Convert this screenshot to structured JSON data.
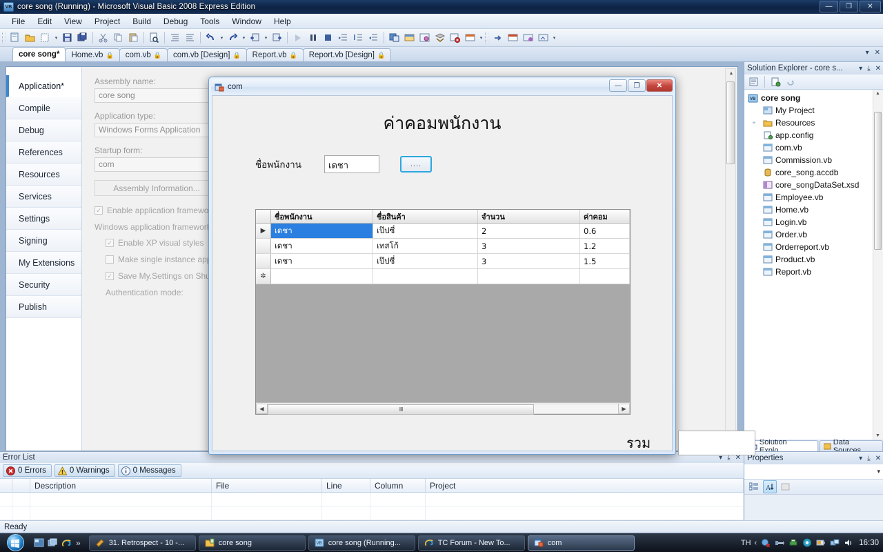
{
  "ide": {
    "title": "core song (Running) - Microsoft Visual Basic 2008 Express Edition",
    "title_icon": "vb-icon",
    "window_buttons": {
      "minimize": "—",
      "maximize": "❐",
      "close": "✕"
    },
    "menu": [
      "File",
      "Edit",
      "View",
      "Project",
      "Build",
      "Debug",
      "Tools",
      "Window",
      "Help"
    ],
    "toolbar_icons": [
      "new-project-icon",
      "open-file-icon",
      "add-new-item-icon",
      "add-item-dropdown",
      "save-icon",
      "save-all-icon",
      "cut-icon",
      "copy-icon",
      "paste-icon",
      "find-in-files-icon",
      "comment-icon",
      "uncomment-icon",
      "undo-icon",
      "undo-dropdown",
      "redo-icon",
      "redo-dropdown",
      "navigate-back-icon",
      "navigate-back-dropdown",
      "navigate-forward-icon",
      "start-debug-icon",
      "pause-icon",
      "stop-icon",
      "step-into-icon",
      "step-over-icon",
      "step-out-icon",
      "solution-explorer-icon",
      "properties-window-icon",
      "object-browser-icon",
      "toolbox-icon",
      "error-list-icon",
      "immediate-window-icon",
      "toolbar-overflow",
      "go-icon",
      "window-1-icon",
      "window-2-icon",
      "window-3-icon",
      "toolbar-overflow-2"
    ],
    "tabs": [
      {
        "label": "core song*",
        "active": true,
        "locked": false
      },
      {
        "label": "Home.vb",
        "active": false,
        "locked": true
      },
      {
        "label": "com.vb",
        "active": false,
        "locked": true
      },
      {
        "label": "com.vb [Design]",
        "active": false,
        "locked": true
      },
      {
        "label": "Report.vb",
        "active": false,
        "locked": true
      },
      {
        "label": "Report.vb [Design]",
        "active": false,
        "locked": true
      }
    ],
    "tabstrip_buttons": {
      "dropdown": "▾",
      "close": "✕"
    },
    "status": "Ready"
  },
  "property_page": {
    "tabs": [
      "Application*",
      "Compile",
      "Debug",
      "References",
      "Resources",
      "Services",
      "Settings",
      "Signing",
      "My Extensions",
      "Security",
      "Publish"
    ],
    "active_tab": "Application*",
    "fields": [
      {
        "label": "Assembly name:",
        "value": "core song"
      },
      {
        "label": "Application type:",
        "value": "Windows Forms Application"
      },
      {
        "label": "Startup form:",
        "value": "com"
      }
    ],
    "assembly_info_button": "Assembly Information...",
    "enable_framework": {
      "label": "Enable application framework",
      "checked": true,
      "mark": "✓"
    },
    "framework_group": "Windows application framework properties",
    "framework_options": [
      {
        "label": "Enable XP visual styles",
        "checked": true,
        "mark": "✓"
      },
      {
        "label": "Make single instance application",
        "checked": false,
        "mark": ""
      },
      {
        "label": "Save My.Settings on Shutdown",
        "checked": true,
        "mark": "✓"
      }
    ],
    "auth_label": "Authentication mode:",
    "scroll_up": "▲",
    "scroll_down": "▼"
  },
  "error_list": {
    "title": "Error List",
    "panel_buttons": {
      "dropdown": "▾",
      "pin": "⤓",
      "close": "✕"
    },
    "pills": [
      {
        "icon": "error-icon",
        "label": "0 Errors",
        "color": "#cc2b2b"
      },
      {
        "icon": "warning-icon",
        "label": "0 Warnings",
        "color": "#ffd24a"
      },
      {
        "icon": "info-icon",
        "label": "0 Messages",
        "color": "#4a6f9e"
      }
    ],
    "columns": [
      "",
      "",
      "Description",
      "File",
      "Line",
      "Column",
      "Project"
    ]
  },
  "solution_explorer": {
    "title": "Solution Explorer - core s...",
    "panel_buttons": {
      "dropdown": "▾",
      "pin": "⤓",
      "close": "✕"
    },
    "toolbar_icons": [
      "properties-icon",
      "show-all-files-icon",
      "refresh-icon"
    ],
    "root": {
      "label": "core song",
      "icon": "vb-project-icon"
    },
    "items": [
      {
        "label": "My Project",
        "icon": "my-project-icon",
        "expander": ""
      },
      {
        "label": "Resources",
        "icon": "folder-icon",
        "expander": "+"
      },
      {
        "label": "app.config",
        "icon": "config-file-icon",
        "expander": ""
      },
      {
        "label": "com.vb",
        "icon": "form-icon",
        "expander": ""
      },
      {
        "label": "Commission.vb",
        "icon": "form-icon",
        "expander": ""
      },
      {
        "label": "core_song.accdb",
        "icon": "database-icon",
        "expander": ""
      },
      {
        "label": "core_songDataSet.xsd",
        "icon": "dataset-icon",
        "expander": ""
      },
      {
        "label": "Employee.vb",
        "icon": "form-icon",
        "expander": ""
      },
      {
        "label": "Home.vb",
        "icon": "form-icon",
        "expander": ""
      },
      {
        "label": "Login.vb",
        "icon": "form-icon",
        "expander": ""
      },
      {
        "label": "Order.vb",
        "icon": "form-icon",
        "expander": ""
      },
      {
        "label": "Orderreport.vb",
        "icon": "form-icon",
        "expander": ""
      },
      {
        "label": "Product.vb",
        "icon": "form-icon",
        "expander": ""
      },
      {
        "label": "Report.vb",
        "icon": "form-icon",
        "expander": ""
      }
    ],
    "scroll_up": "▲",
    "scroll_down": "▼",
    "dock_tabs": [
      {
        "label": "Solution Explo...",
        "icon": "solution-explorer-icon",
        "active": true
      },
      {
        "label": "Data Sources",
        "icon": "data-sources-icon",
        "active": false
      }
    ]
  },
  "properties_panel": {
    "title": "Properties",
    "panel_buttons": {
      "dropdown": "▾",
      "pin": "⤓",
      "close": "✕"
    },
    "combo_value": "",
    "combo_arrow": "▾",
    "toolbar_icons": [
      "categorized-icon",
      "alphabetical-icon",
      "property-pages-icon"
    ]
  },
  "com_form": {
    "title": "com",
    "title_icon": "form-icon",
    "buttons": {
      "minimize": "—",
      "maximize": "❐",
      "close": "✕"
    },
    "heading": "ค่าคอมพนักงาน",
    "name_label": "ชื่อพนักงาน",
    "name_value": "เดชา",
    "browse_button": "....",
    "total_label": "รวม",
    "total_value": "",
    "grid": {
      "columns": [
        "ชื่อพนักงาน",
        "ชื่อสินค้า",
        "จำนวน",
        "ค่าคอม"
      ],
      "rows": [
        {
          "marker": "▶",
          "selected": true,
          "cells": [
            "เดชา",
            "เป๊ปซี่",
            "2",
            "0.6"
          ]
        },
        {
          "marker": "",
          "selected": false,
          "cells": [
            "เดชา",
            "เทสโก้",
            "3",
            "1.2"
          ]
        },
        {
          "marker": "",
          "selected": false,
          "cells": [
            "เดชา",
            "เป๊ปซี่",
            "3",
            "1.5"
          ]
        },
        {
          "marker": "✲",
          "selected": false,
          "cells": [
            "",
            "",
            "",
            ""
          ]
        }
      ],
      "hscroll": {
        "left": "◀",
        "right": "▶",
        "grip": "‖‖"
      }
    }
  },
  "taskbar": {
    "start_icon": "windows-orb-icon",
    "quick_launch": [
      {
        "icon": "show-desktop-icon"
      },
      {
        "icon": "switch-windows-icon"
      },
      {
        "icon": "internet-explorer-icon"
      }
    ],
    "overflow": "»",
    "items": [
      {
        "label": "31. Retrospect - 10 -...",
        "icon": "media-icon",
        "active": false
      },
      {
        "label": "core song",
        "icon": "folder-icon",
        "active": false
      },
      {
        "label": "core song (Running...",
        "icon": "vb-icon",
        "active": false
      },
      {
        "label": "TC Forum - New To...",
        "icon": "internet-explorer-icon",
        "active": false
      },
      {
        "label": "com",
        "icon": "form-icon",
        "active": true
      }
    ],
    "language": "TH",
    "tray_expand": "‹",
    "tray_icons": [
      "antivirus-icon",
      "usb-icon",
      "printer-icon",
      "security-icon",
      "battery-icon",
      "network-icon",
      "volume-icon"
    ],
    "clock": "16:30"
  }
}
